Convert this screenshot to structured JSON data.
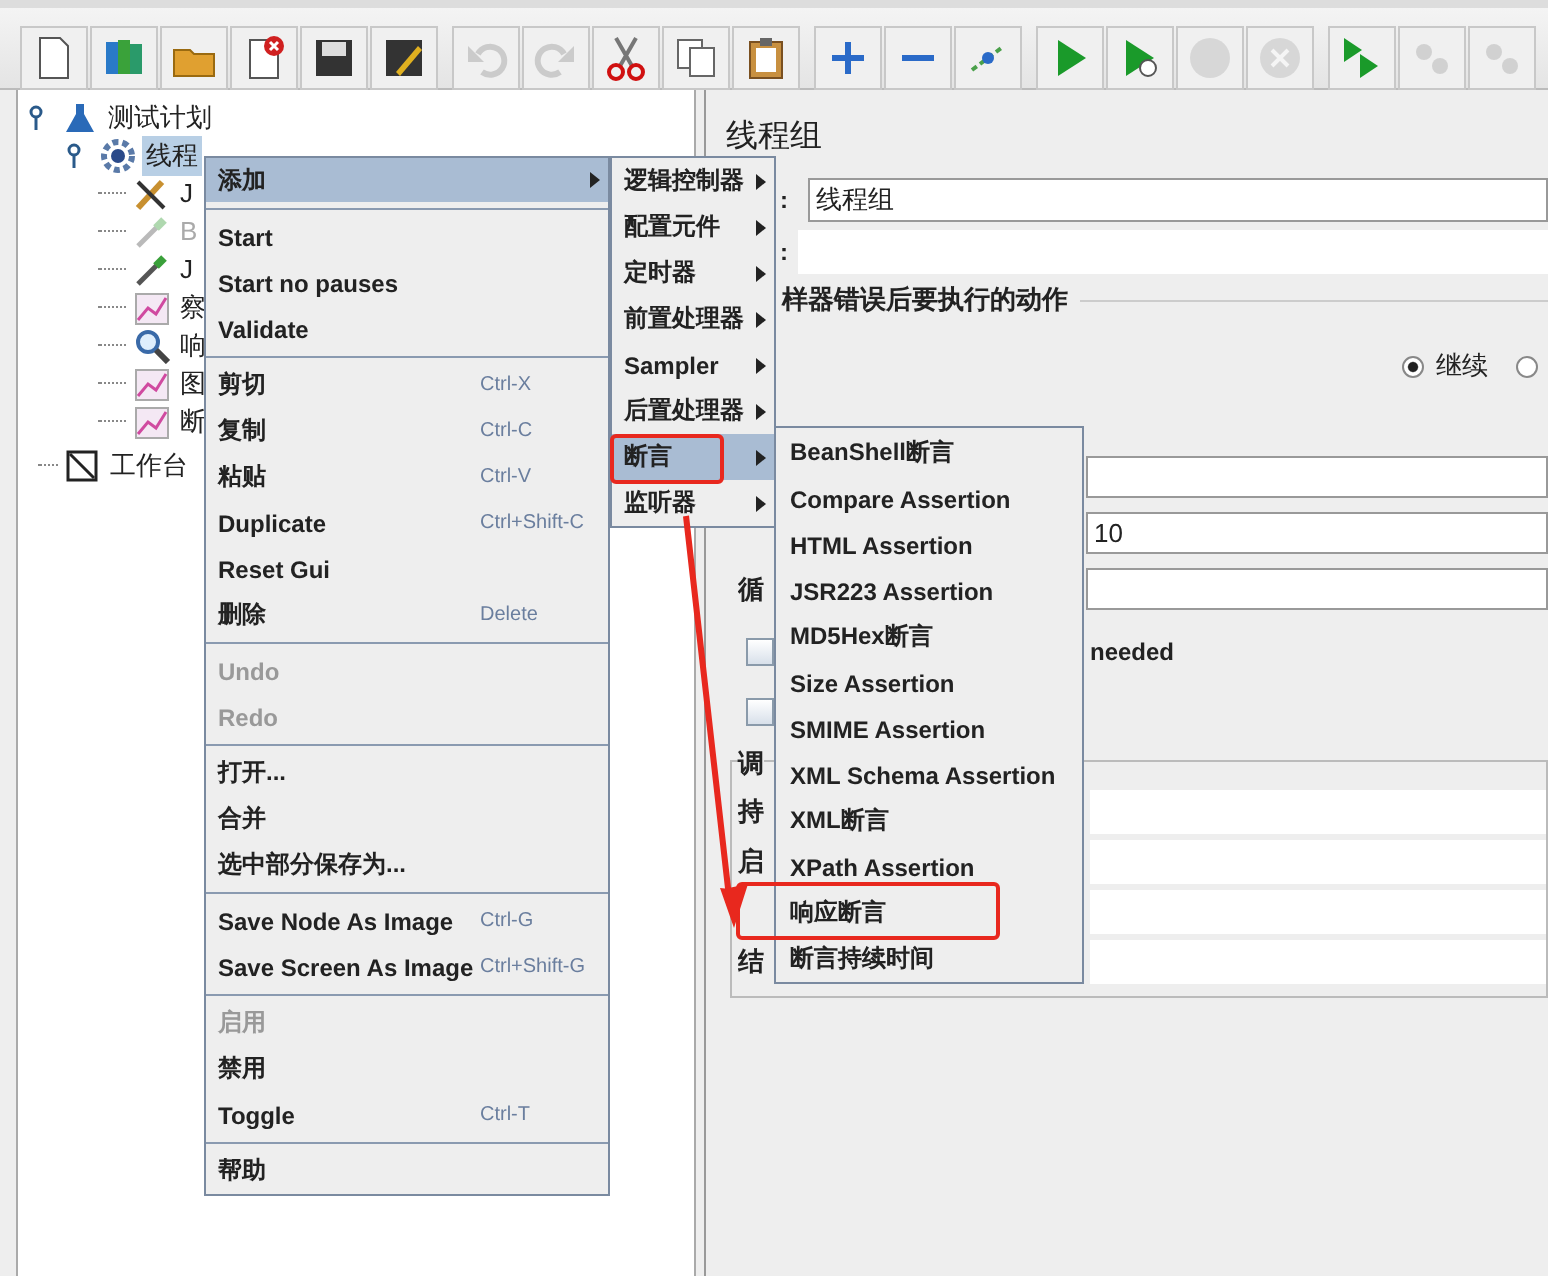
{
  "toolbar": [
    {
      "kind": "new",
      "disabled": false
    },
    {
      "kind": "templates",
      "disabled": false
    },
    {
      "kind": "open",
      "disabled": false
    },
    {
      "kind": "close",
      "disabled": false
    },
    {
      "kind": "save",
      "disabled": false
    },
    {
      "kind": "save-as",
      "disabled": false
    },
    {
      "kind": "undo",
      "disabled": true
    },
    {
      "kind": "redo",
      "disabled": true
    },
    {
      "kind": "cut",
      "disabled": false
    },
    {
      "kind": "copy",
      "disabled": false
    },
    {
      "kind": "paste",
      "disabled": false
    },
    {
      "kind": "expand",
      "disabled": false
    },
    {
      "kind": "collapse",
      "disabled": false
    },
    {
      "kind": "toggle",
      "disabled": false
    },
    {
      "kind": "start",
      "disabled": false
    },
    {
      "kind": "start-no-pause",
      "disabled": false
    },
    {
      "kind": "stop",
      "disabled": true
    },
    {
      "kind": "shutdown",
      "disabled": true
    },
    {
      "kind": "remote-start",
      "disabled": false
    },
    {
      "kind": "remote-stop",
      "disabled": true
    },
    {
      "kind": "remote-exit",
      "disabled": true
    }
  ],
  "tree": [
    {
      "label": "测试计划",
      "kind": "plan",
      "selected": false,
      "expanded": true,
      "children": [
        {
          "label": "线程",
          "kind": "gear",
          "selected": true,
          "expanded": true,
          "children": [
            {
              "label": "J",
              "kind": "tools",
              "disabled": false
            },
            {
              "label": "B",
              "kind": "pipette",
              "disabled": true
            },
            {
              "label": "J",
              "kind": "pipette",
              "disabled": false
            },
            {
              "label": "察",
              "kind": "chart",
              "disabled": false
            },
            {
              "label": "响",
              "kind": "magnifier",
              "disabled": false
            },
            {
              "label": "图",
              "kind": "chart",
              "disabled": false
            },
            {
              "label": "断",
              "kind": "chart",
              "disabled": false
            }
          ]
        }
      ]
    },
    {
      "label": "工作台",
      "kind": "workbench",
      "selected": false
    }
  ],
  "panel": {
    "title": "线程组",
    "name_label": ":",
    "name_value": "线程组",
    "comment_label": ":",
    "error_section": "样器错误后要执行的动作",
    "error_actions": [
      {
        "label": "继续",
        "selected": true
      },
      {
        "selected": false
      }
    ],
    "rows": [
      {
        "kind": "field"
      },
      {
        "kind": "field",
        "value": "10"
      },
      {
        "kind": "field",
        "label": "循"
      },
      {
        "kind": "checkbox",
        "checked": false,
        "label": "needed"
      },
      {
        "kind": "checkbox",
        "checked": false
      }
    ],
    "scheduler": {
      "title": "调",
      "rows": [
        {
          "label": "持"
        },
        {
          "label": "启"
        },
        {},
        {
          "label": "结"
        }
      ]
    }
  },
  "context_menu": [
    [
      {
        "label": "添加",
        "submenu": true,
        "selected": true,
        "disabled": false
      }
    ],
    [
      {
        "label": "Start",
        "selected": false,
        "disabled": false
      },
      {
        "label": "Start no pauses",
        "selected": false,
        "disabled": false
      },
      {
        "label": "Validate",
        "selected": false,
        "disabled": false
      }
    ],
    [
      {
        "label": "剪切",
        "shortcut": "Ctrl-X",
        "selected": false,
        "disabled": false
      },
      {
        "label": "复制",
        "shortcut": "Ctrl-C",
        "selected": false,
        "disabled": false
      },
      {
        "label": "粘贴",
        "shortcut": "Ctrl-V",
        "selected": false,
        "disabled": false
      },
      {
        "label": "Duplicate",
        "shortcut": "Ctrl+Shift-C",
        "selected": false,
        "disabled": false
      },
      {
        "label": "Reset Gui",
        "selected": false,
        "disabled": false
      },
      {
        "label": "删除",
        "shortcut": "Delete",
        "selected": false,
        "disabled": false
      }
    ],
    [
      {
        "label": "Undo",
        "selected": false,
        "disabled": true
      },
      {
        "label": "Redo",
        "selected": false,
        "disabled": true
      }
    ],
    [
      {
        "label": "打开...",
        "selected": false,
        "disabled": false
      },
      {
        "label": "合并",
        "selected": false,
        "disabled": false
      },
      {
        "label": "选中部分保存为...",
        "selected": false,
        "disabled": false
      }
    ],
    [
      {
        "label": "Save Node As Image",
        "shortcut": "Ctrl-G",
        "selected": false,
        "disabled": false
      },
      {
        "label": "Save Screen As Image",
        "shortcut": "Ctrl+Shift-G",
        "selected": false,
        "disabled": false
      }
    ],
    [
      {
        "label": "启用",
        "selected": false,
        "disabled": true
      },
      {
        "label": "禁用",
        "selected": false,
        "disabled": false
      },
      {
        "label": "Toggle",
        "shortcut": "Ctrl-T",
        "selected": false,
        "disabled": false
      }
    ],
    [
      {
        "label": "帮助",
        "selected": false,
        "disabled": false
      }
    ]
  ],
  "add_submenu": [
    {
      "label": "逻辑控制器",
      "selected": false
    },
    {
      "label": "配置元件",
      "selected": false
    },
    {
      "label": "定时器",
      "selected": false
    },
    {
      "label": "前置处理器",
      "selected": false
    },
    {
      "label": "Sampler",
      "selected": false
    },
    {
      "label": "后置处理器",
      "selected": false
    },
    {
      "label": "断言",
      "selected": true
    },
    {
      "label": "监听器",
      "selected": false
    }
  ],
  "assertion_submenu": [
    {
      "label": "BeanShell断言"
    },
    {
      "label": "Compare Assertion"
    },
    {
      "label": "HTML Assertion"
    },
    {
      "label": "JSR223 Assertion"
    },
    {
      "label": "MD5Hex断言"
    },
    {
      "label": "Size Assertion"
    },
    {
      "label": "SMIME Assertion"
    },
    {
      "label": "XML Schema Assertion"
    },
    {
      "label": "XML断言"
    },
    {
      "label": "XPath Assertion"
    },
    {
      "label": "响应断言"
    },
    {
      "label": "断言持续时间"
    }
  ]
}
